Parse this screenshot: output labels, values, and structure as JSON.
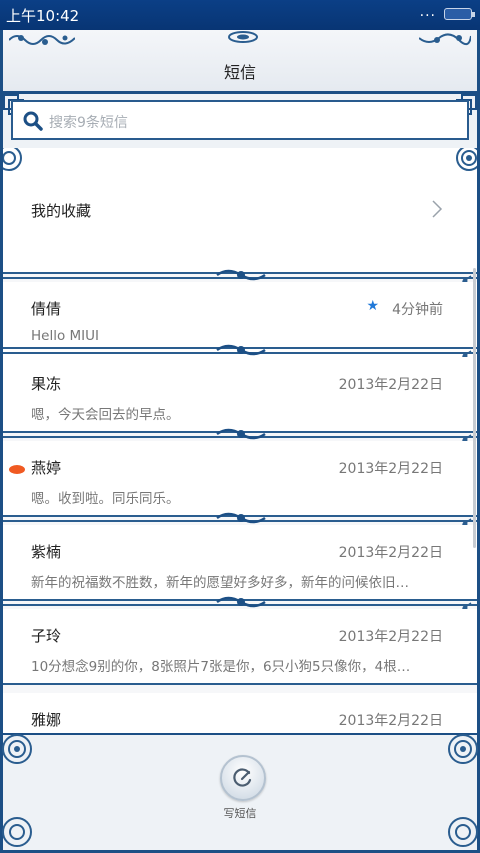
{
  "status_bar": {
    "time": "上午10:42",
    "dots": "...",
    "icons": [
      "battery-icon"
    ]
  },
  "header": {
    "title": "短信"
  },
  "search": {
    "placeholder": "搜索9条短信"
  },
  "favorites": {
    "label": "我的收藏"
  },
  "conversations": [
    {
      "name": "倩倩",
      "date": "4分钟前",
      "snippet": "Hello MIUI",
      "starred": true,
      "unread": false
    },
    {
      "name": "果冻",
      "date": "2013年2月22日",
      "snippet": "嗯，今天会回去的早点。",
      "starred": false,
      "unread": false
    },
    {
      "name": "燕婷",
      "date": "2013年2月22日",
      "snippet": "嗯。收到啦。同乐同乐。",
      "starred": false,
      "unread": true
    },
    {
      "name": "紫楠",
      "date": "2013年2月22日",
      "snippet": "新年的祝福数不胜数，新年的愿望好多好多，新年的问候依旧…",
      "starred": false,
      "unread": false
    },
    {
      "name": "子玲",
      "date": "2013年2月22日",
      "snippet": "10分想念9别的你，8张照片7张是你，6只小狗5只像你，4根…",
      "starred": false,
      "unread": false
    },
    {
      "name": "雅娜",
      "date": "2013年2月22日",
      "snippet": "",
      "starred": false,
      "unread": false
    }
  ],
  "bottom_bar": {
    "compose_label": "写短信"
  },
  "colors": {
    "accent": "#1c4f85",
    "unread": "#f05a22",
    "star": "#1f78d8"
  }
}
